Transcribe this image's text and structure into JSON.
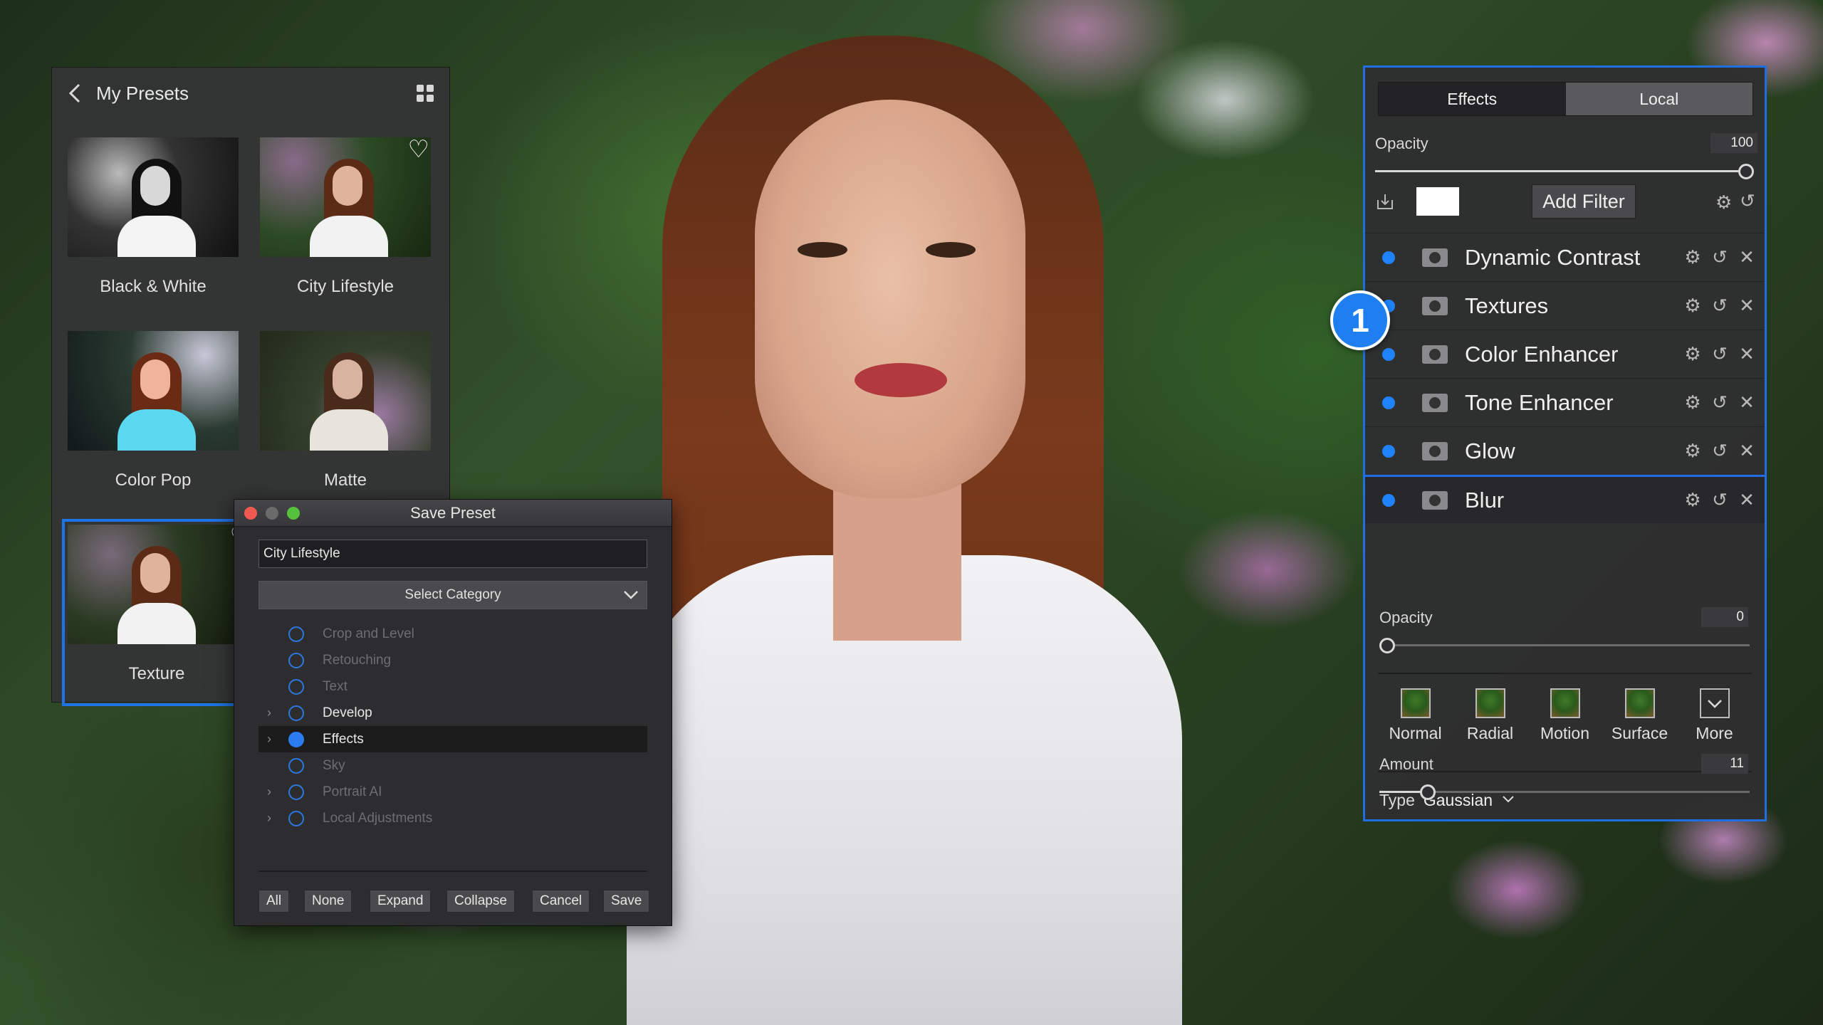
{
  "presets": {
    "title": "My Presets",
    "tiles": [
      {
        "label": "Black & White",
        "favorite": false,
        "selected": false
      },
      {
        "label": "City Lifestyle",
        "favorite": true,
        "selected": false
      },
      {
        "label": "Color Pop",
        "favorite": false,
        "selected": false
      },
      {
        "label": "Matte",
        "favorite": false,
        "selected": false
      },
      {
        "label": "Texture",
        "favorite": true,
        "selected": true
      }
    ]
  },
  "save_dialog": {
    "title": "Save Preset",
    "name_value": "City Lifestyle",
    "category_placeholder": "Select Category",
    "categories": [
      {
        "label": "Crop and Level",
        "expandable": false,
        "checked": false,
        "enabled": false
      },
      {
        "label": "Retouching",
        "expandable": false,
        "checked": false,
        "enabled": false
      },
      {
        "label": "Text",
        "expandable": false,
        "checked": false,
        "enabled": false
      },
      {
        "label": "Develop",
        "expandable": true,
        "checked": false,
        "enabled": true
      },
      {
        "label": "Effects",
        "expandable": true,
        "checked": true,
        "enabled": true
      },
      {
        "label": "Sky",
        "expandable": false,
        "checked": false,
        "enabled": false
      },
      {
        "label": "Portrait AI",
        "expandable": true,
        "checked": false,
        "enabled": false
      },
      {
        "label": "Local Adjustments",
        "expandable": true,
        "checked": false,
        "enabled": false
      }
    ],
    "buttons": {
      "all": "All",
      "none": "None",
      "expand": "Expand",
      "collapse": "Collapse",
      "cancel": "Cancel",
      "save": "Save"
    }
  },
  "filters_panel": {
    "tabs": [
      "Effects",
      "Local"
    ],
    "active_tab": "Effects",
    "opacity_label": "Opacity",
    "opacity_value": "100",
    "add_filter_label": "Add Filter",
    "filters": [
      "Dynamic Contrast",
      "Textures",
      "Color Enhancer",
      "Tone Enhancer",
      "Glow",
      "Blur"
    ],
    "blur": {
      "opacity_label": "Opacity",
      "opacity_value": "0",
      "modes": [
        "Normal",
        "Radial",
        "Motion",
        "Surface",
        "More"
      ],
      "type_label": "Type",
      "type_value": "Gaussian",
      "amount_label": "Amount",
      "amount_value": "11"
    }
  },
  "callout_number": "1",
  "colors": {
    "accent": "#1f6fe3",
    "dot": "#1f83ff",
    "panel": "#2e2e30"
  }
}
